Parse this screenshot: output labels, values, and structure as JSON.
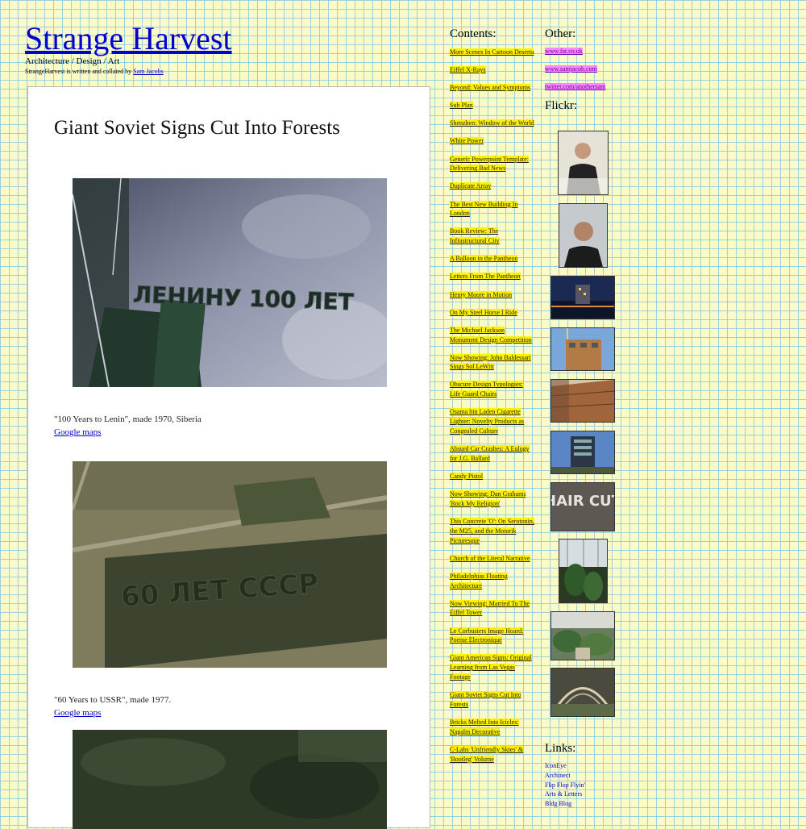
{
  "header": {
    "title": "Strange Harvest ",
    "tagline": "Architecture / Design / Art",
    "credit_text": "StrangeHarvest is written and collated by ",
    "credit_link": "Sam Jacobs"
  },
  "post": {
    "title": "Giant Soviet Signs Cut Into Forests",
    "captions": [
      {
        "text": "\"100 Years to Lenin\", made 1970, Siberia",
        "link": "Google maps"
      },
      {
        "text": "\"60 Years to USSR\", made 1977.",
        "link": "Google maps"
      }
    ],
    "image_texts": [
      "ЛЕНИНУ 100 ЛЕТ",
      "60 ЛЕТ СССР"
    ]
  },
  "sidebar": {
    "contents_heading": "Contents:",
    "contents": [
      "More Scenes In Cartoon Deserta",
      "Eiffel X-Rays",
      "Beyond: Values and Symptoms",
      "Sub Plan",
      "Shenzhen: Window of the World",
      "White Power",
      "Generic Powerpoint Template: Delivering Bad News",
      "Duplicate Array",
      "The Best New Building In London",
      "Book Review: The Infrastructural City",
      "A Balloon in the Pantheon",
      "Letters From The Pantheon",
      "Henry Moore in Motion",
      "On My Steel Horse I Ride",
      "The Michael Jackson Monument Design Competition",
      "Now Showing: John Baldessari Sings Sol LeWitt",
      "Obscure Design Typologies: Life Guard Chairs",
      "Osama bin Laden Cigarette Lighter: Novelty Products as Congealed Culture",
      "Absurd Car Crashes: A Eulogy for J.G. Ballard",
      "Candy Pistol",
      "Now Showing: Dan Grahams 'Rock My Religion'",
      "This Concrete 'O': On Serotonin, the M25, and the Motorik Picturesque",
      "Church of the Literal Narrative",
      "Philadelphias Floating Architecture",
      "Now Viewing: Married To The Eiffel Tower",
      "Le Corbusiers Image Hoard: Poeme Electronique",
      "Giant American Signs: Original Learning from Las Vegas Footage",
      "Giant Soviet Signs Cut Into Forests",
      "Bricks Melted Into Icicles: Napalm Decorative",
      "C-Labs 'Unfriendly Skies' & 'Bootleg' Volume"
    ],
    "other_heading": "Other:",
    "other_links": [
      "www.fat.co.uk",
      "www.samjacob.com",
      "twitter.com/anothersam"
    ],
    "flickr_heading": "Flickr:",
    "flickr_thumb_text": "HAIR CUT",
    "links_heading": "Links:",
    "links": [
      "IconEye",
      "Archinect",
      "Flip Flop Flyin'",
      "Arts & Letters",
      "Bldg Blog"
    ]
  },
  "colors": {
    "grid_background": "#fbfbc8",
    "grid_lines": "#9fd0d8",
    "contents_highlight": "#fff200",
    "other_highlight": "#ff88ff"
  }
}
